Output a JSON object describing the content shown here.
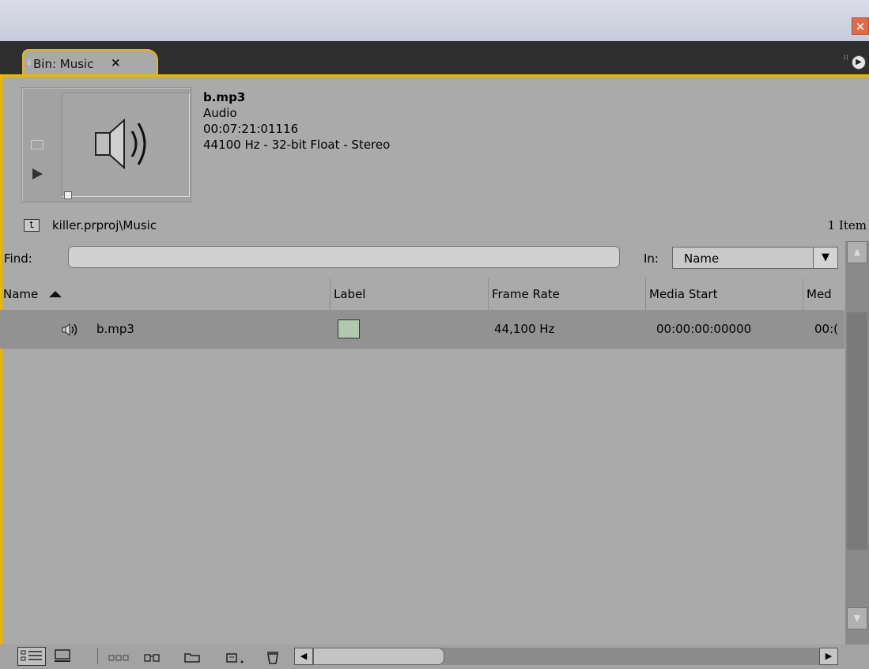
{
  "window": {
    "close_glyph": "✕"
  },
  "panel": {
    "tab_label": "Bin: Music",
    "tab_close": "×"
  },
  "clip": {
    "name": "b.mp3",
    "type": "Audio",
    "duration": "00:07:21:01116",
    "format": "44100 Hz - 32-bit Float - Stereo"
  },
  "path": {
    "location": "killer.prproj\\Music",
    "item_count": "1 Item"
  },
  "find": {
    "label": "Find:",
    "value": "",
    "in_label": "In:",
    "in_value": "Name"
  },
  "table": {
    "columns": [
      "Name",
      "Label",
      "Frame Rate",
      "Media Start",
      "Med"
    ],
    "rows": [
      {
        "name": "b.mp3",
        "label_color": "#b0c8ae",
        "frame_rate": "44,100 Hz",
        "media_start": "00:00:00:00000",
        "media_end_partial": "00:("
      }
    ]
  },
  "colors": {
    "accent": "#f0b400",
    "panel_bg": "#aaaaaa",
    "selected_row": "#929292"
  },
  "icons": {
    "speaker": "speaker-icon",
    "play": "play-icon",
    "camera": "camera-icon",
    "up_folder": "up-folder-icon"
  }
}
